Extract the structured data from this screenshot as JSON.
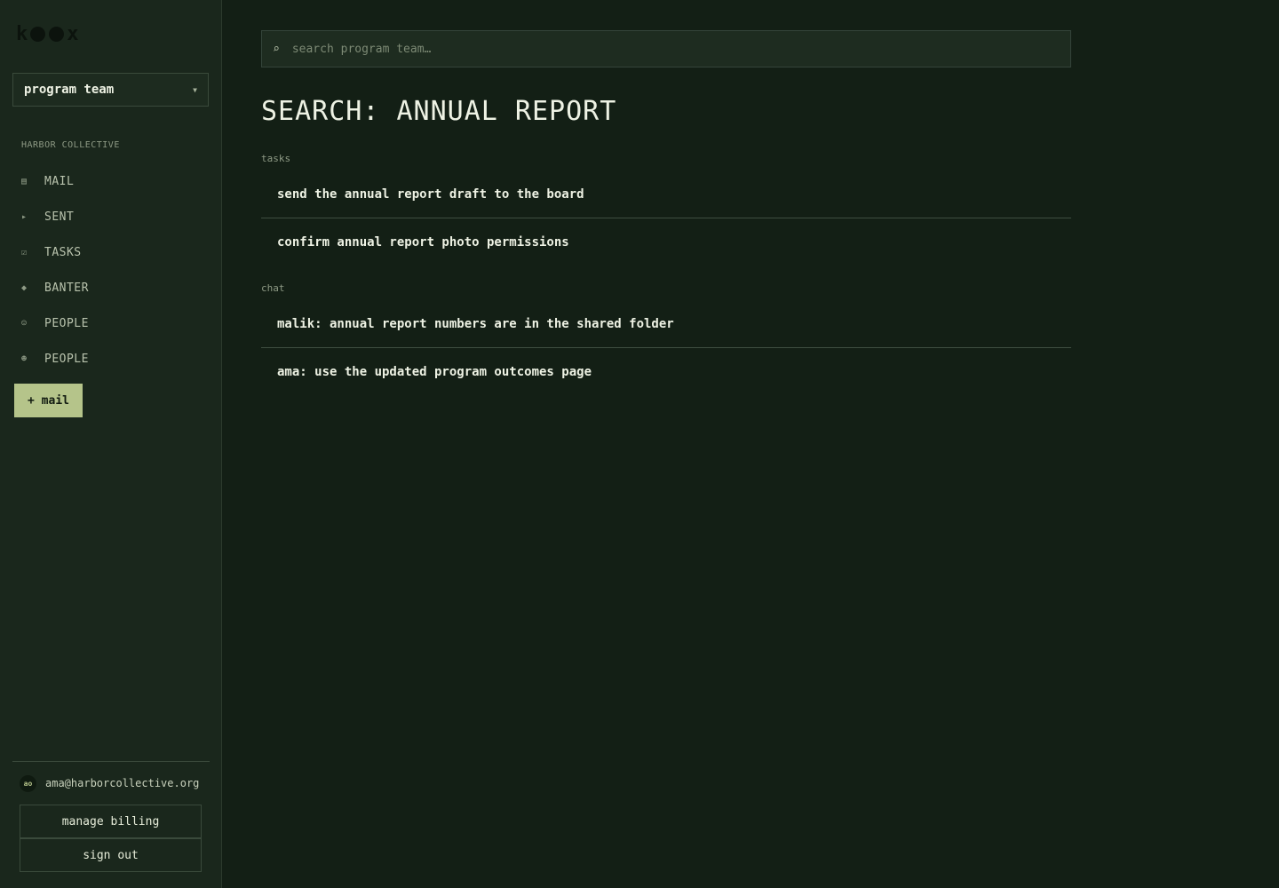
{
  "app": {
    "logo_left": "k",
    "logo_right": "x"
  },
  "sidebar": {
    "team_select": {
      "value": "program team"
    },
    "org_label": "HARBOR COLLECTIVE",
    "nav": [
      {
        "icon": "inbox-icon",
        "glyph": "▤",
        "label": "MAIL"
      },
      {
        "icon": "send-icon",
        "glyph": "▸",
        "label": "SENT"
      },
      {
        "icon": "checkbox-icon",
        "glyph": "☑",
        "label": "TASKS"
      },
      {
        "icon": "diamond-icon",
        "glyph": "◆",
        "label": "BANTER"
      },
      {
        "icon": "smiley-icon",
        "glyph": "☺",
        "label": "PEOPLE"
      },
      {
        "icon": "contacts-icon",
        "glyph": "☻",
        "label": "PEOPLE"
      }
    ],
    "compose_label": "+ mail",
    "account": {
      "initials": "ao",
      "email": "ama@harborcollective.org"
    },
    "billing_label": "manage billing",
    "signout_label": "sign out"
  },
  "main": {
    "search": {
      "placeholder": "search program team…",
      "value": ""
    },
    "title": "SEARCH: ANNUAL REPORT",
    "groups": [
      {
        "label": "tasks",
        "items": [
          "send the annual report draft to the board",
          "confirm annual report photo permissions"
        ]
      },
      {
        "label": "chat",
        "items": [
          "malik: annual report numbers are in the shared folder",
          "ama: use the updated program outcomes page"
        ]
      }
    ]
  },
  "colors": {
    "background": "#131f15",
    "sidebar": "#1a271c",
    "accent": "#b5c48a"
  }
}
